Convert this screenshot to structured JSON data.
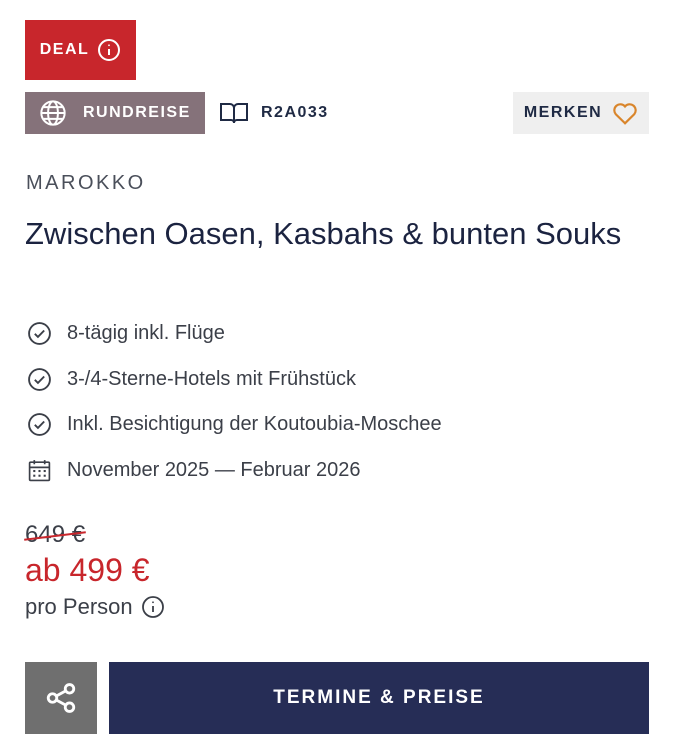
{
  "badge": {
    "label": "DEAL",
    "icon": "info-icon"
  },
  "trip_type": {
    "label": "RUNDREISE",
    "icon": "globe-icon"
  },
  "catalog": {
    "code": "R2A033",
    "icon": "book-icon"
  },
  "favorite": {
    "label": "MERKEN",
    "icon": "heart-icon"
  },
  "country": "MAROKKO",
  "title": "Zwischen Oasen, Kasbahs & bunten Souks",
  "features": [
    {
      "text": "8-tägig inkl. Flüge",
      "icon": "check-circle-icon"
    },
    {
      "text": "3-/4-Sterne-Hotels mit Frühstück",
      "icon": "check-circle-icon"
    },
    {
      "text": "Inkl. Besichtigung der Koutoubia-Moschee",
      "icon": "check-circle-icon"
    },
    {
      "text": "November 2025 — Februar 2026",
      "icon": "calendar-icon"
    }
  ],
  "pricing": {
    "old_price": "649 €",
    "price": "ab 499 €",
    "per_person": "pro Person"
  },
  "actions": {
    "share_icon": "share-icon",
    "cta_label": "TERMINE & PREISE"
  },
  "colors": {
    "deal_red": "#c8262c",
    "tag_mauve": "#85727a",
    "navy": "#262d56",
    "heart_orange": "#d9852b",
    "share_gray": "#6f6f6f"
  }
}
